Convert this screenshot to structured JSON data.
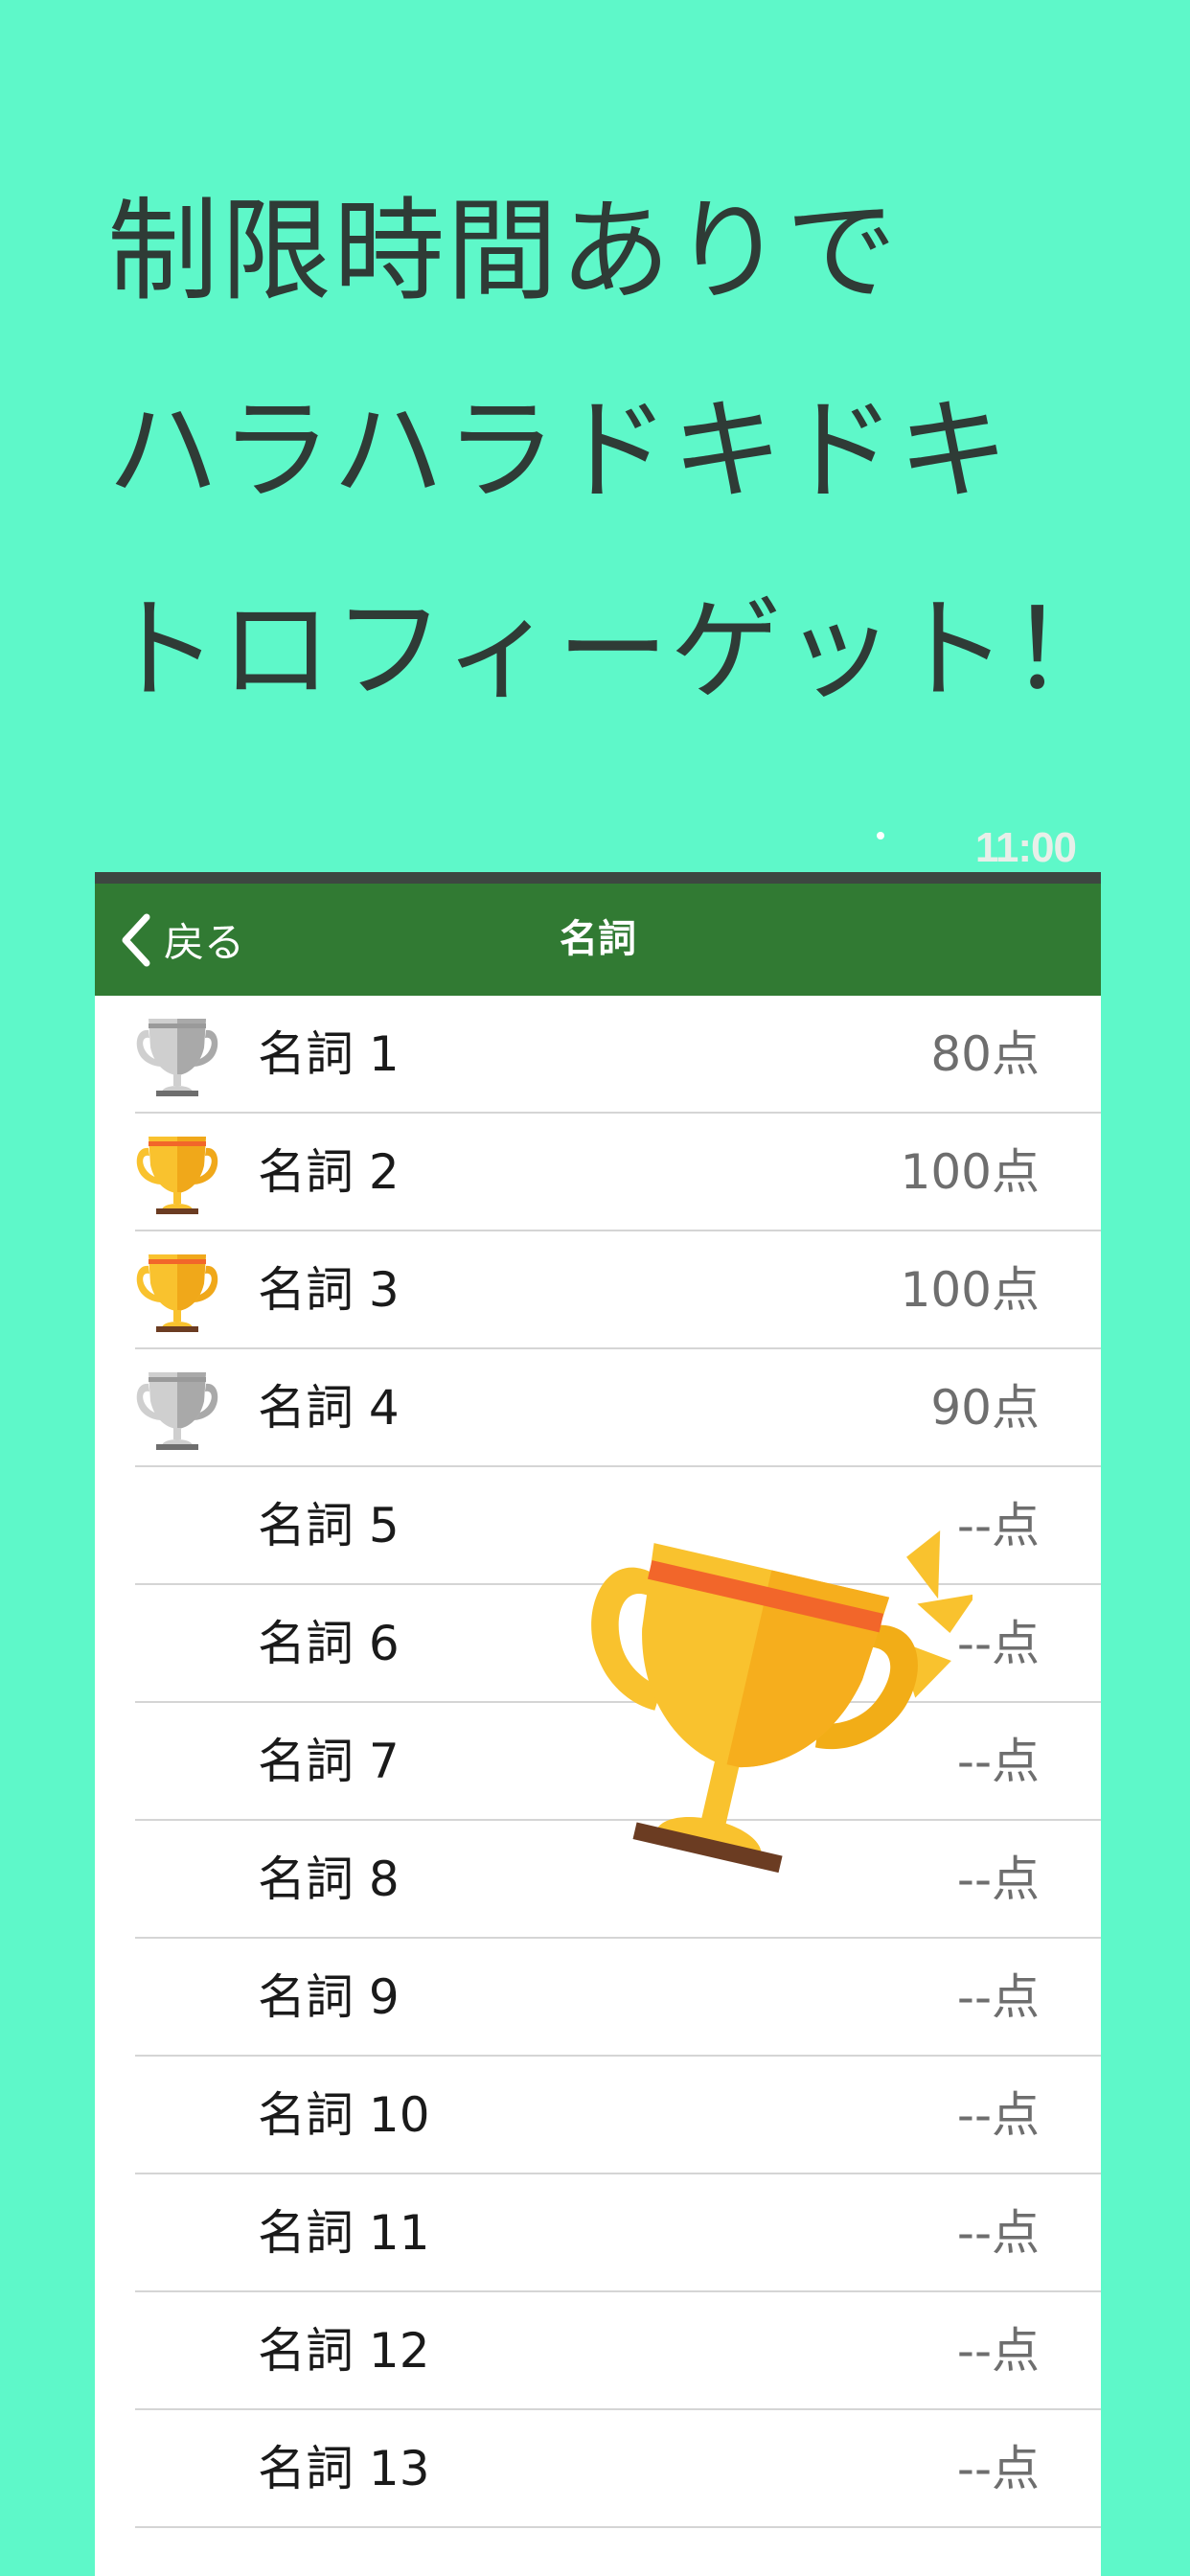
{
  "headline": {
    "line1": "制限時間ありで",
    "line2": "ハラハラドキドキ",
    "line3": "トロフィーゲット！"
  },
  "status_bar": {
    "time": "11:00"
  },
  "nav": {
    "back_label": "戻る",
    "title": "名詞"
  },
  "rows": [
    {
      "label": "名詞 1",
      "score": "80点",
      "trophy": "silver-trophy-icon"
    },
    {
      "label": "名詞 2",
      "score": "100点",
      "trophy": "gold-trophy-icon"
    },
    {
      "label": "名詞 3",
      "score": "100点",
      "trophy": "gold-trophy-icon"
    },
    {
      "label": "名詞 4",
      "score": "90点",
      "trophy": "silver-trophy-icon"
    },
    {
      "label": "名詞 5",
      "score": "--点",
      "trophy": null
    },
    {
      "label": "名詞 6",
      "score": "--点",
      "trophy": null
    },
    {
      "label": "名詞 7",
      "score": "--点",
      "trophy": null
    },
    {
      "label": "名詞 8",
      "score": "--点",
      "trophy": null
    },
    {
      "label": "名詞 9",
      "score": "--点",
      "trophy": null
    },
    {
      "label": "名詞 10",
      "score": "--点",
      "trophy": null
    },
    {
      "label": "名詞 11",
      "score": "--点",
      "trophy": null
    },
    {
      "label": "名詞 12",
      "score": "--点",
      "trophy": null
    },
    {
      "label": "名詞 13",
      "score": "--点",
      "trophy": null
    }
  ],
  "colors": {
    "background": "#5ef8c9",
    "navbar": "#317a33",
    "headline_text": "#2f3b36",
    "gold": "#f9c22e",
    "silver": "#c9c9c9",
    "gold_band": "#f2662a"
  },
  "decoration": {
    "icon": "large-gold-trophy-icon"
  }
}
